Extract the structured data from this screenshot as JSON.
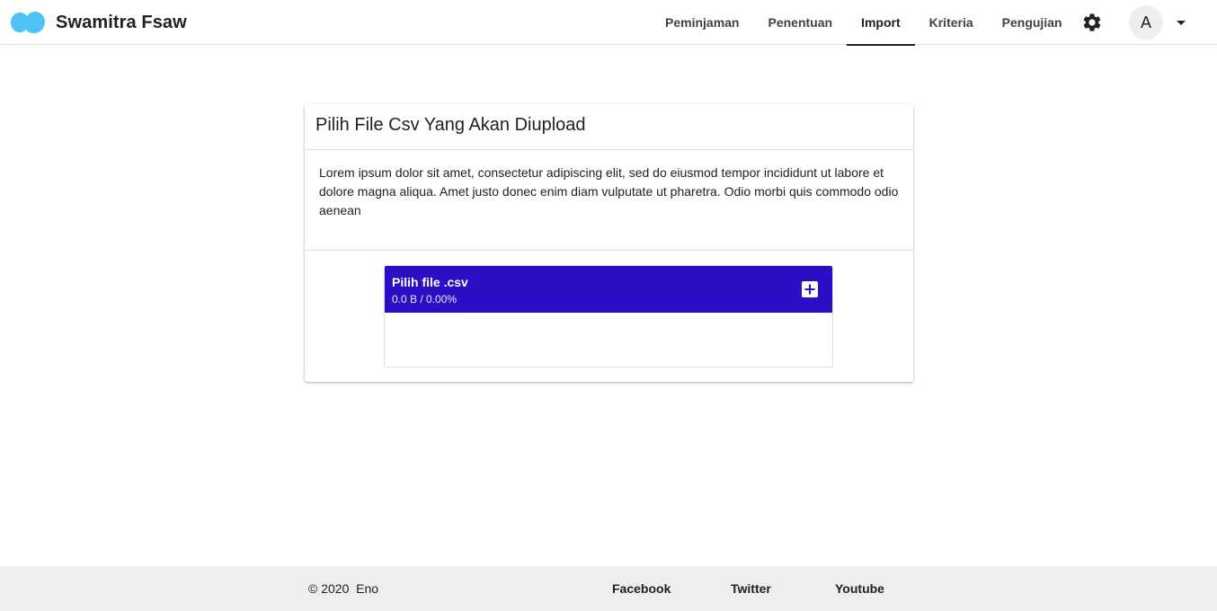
{
  "brand": {
    "title": "Swamitra Fsaw",
    "logo_icon": "cloud-logo-icon",
    "logo_color": "#4fc3f7"
  },
  "nav": {
    "items": [
      {
        "label": "Peminjaman",
        "active": false
      },
      {
        "label": "Penentuan",
        "active": false
      },
      {
        "label": "Import",
        "active": true
      },
      {
        "label": "Kriteria",
        "active": false
      },
      {
        "label": "Pengujian",
        "active": false
      }
    ],
    "settings_icon": "gear-icon",
    "avatar_initial": "A",
    "avatar_caret_icon": "caret-down-icon"
  },
  "card": {
    "title": "Pilih File Csv Yang Akan Diupload",
    "description": "Lorem ipsum dolor sit amet, consectetur adipiscing elit, sed do eiusmod tempor incididunt ut labore et dolore magna aliqua. Amet justo donec enim diam vulputate ut pharetra. Odio morbi quis commodo odio aenean"
  },
  "uploader": {
    "label": "Pilih file .csv",
    "status": "0.0 B / 0.00%",
    "add_icon": "add-box-icon",
    "header_color": "#2a0fc4"
  },
  "footer": {
    "copyright": "© 2020  Eno",
    "links": [
      "Facebook",
      "Twitter",
      "Youtube"
    ]
  }
}
